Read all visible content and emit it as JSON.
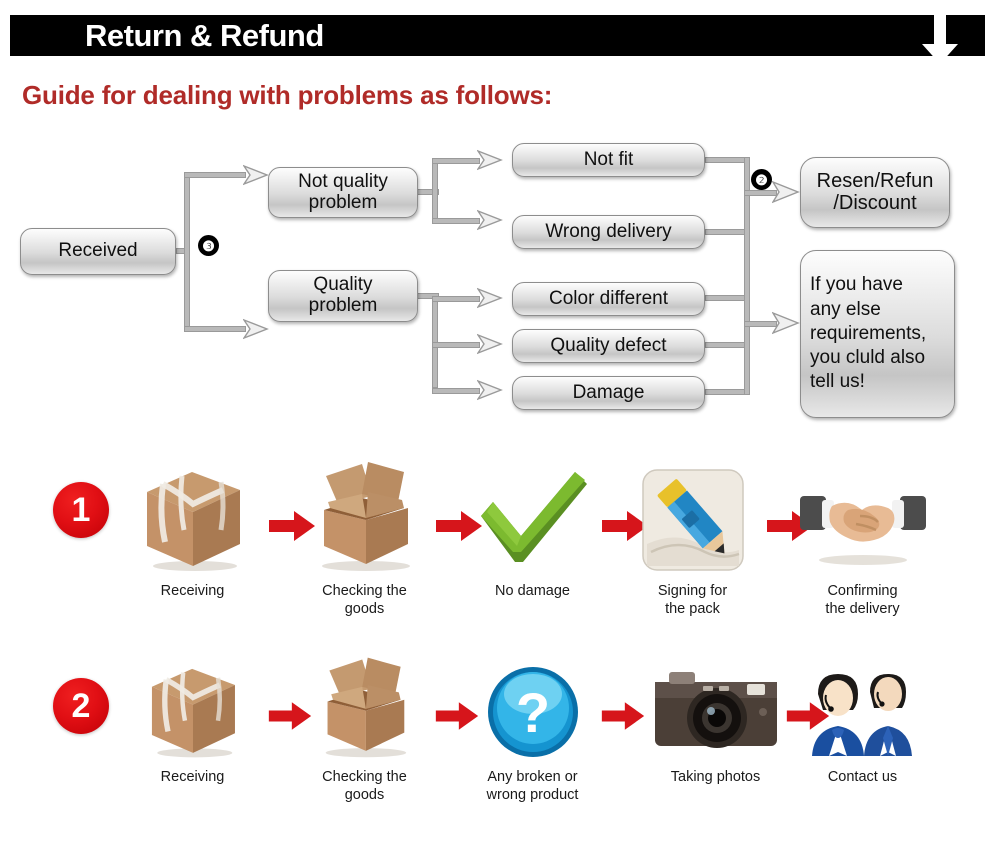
{
  "header": {
    "title": "Return & Refund",
    "down_arrow_icon": "arrow-down-icon",
    "bar_color": "#000000",
    "title_color": "#ffffff"
  },
  "guide": {
    "title": "Guide for dealing with problems as follows:",
    "color": "#b02b28"
  },
  "flowchart": {
    "start": {
      "label": "Received"
    },
    "branch_badge": "❸",
    "merge_badge": "❷",
    "categories": [
      {
        "label": "Not quality\nproblem"
      },
      {
        "label": "Quality\nproblem"
      }
    ],
    "problems": [
      {
        "label": "Not fit"
      },
      {
        "label": "Wrong delivery"
      },
      {
        "label": "Color different"
      },
      {
        "label": "Quality defect"
      },
      {
        "label": "Damage"
      }
    ],
    "outcomes": [
      {
        "label": "Resen/Refun\n/Discount"
      },
      {
        "label": "If you have\nany else\nrequirements,\nyou cluld also\ntell us!"
      }
    ]
  },
  "processes": [
    {
      "badge": "1",
      "steps": [
        {
          "label": "Receiving",
          "icon": "sealed-box-icon"
        },
        {
          "label": "Checking the\ngoods",
          "icon": "open-box-icon"
        },
        {
          "label": "No damage",
          "icon": "green-checkmark-icon"
        },
        {
          "label": "Signing for\nthe pack",
          "icon": "pencil-signing-icon"
        },
        {
          "label": "Confirming\nthe delivery",
          "icon": "handshake-icon"
        }
      ]
    },
    {
      "badge": "2",
      "steps": [
        {
          "label": "Receiving",
          "icon": "sealed-box-icon"
        },
        {
          "label": "Checking the\ngoods",
          "icon": "open-box-icon"
        },
        {
          "label": "Any broken or\nwrong product",
          "icon": "question-mark-icon"
        },
        {
          "label": "Taking photos",
          "icon": "camera-icon"
        },
        {
          "label": "Contact us",
          "icon": "support-agents-icon"
        }
      ]
    }
  ],
  "colors": {
    "red_badge": "#e10f14",
    "red_arrow": "#d6151b",
    "box_border": "#8d8d8d",
    "connector": "#b9b9b9"
  }
}
